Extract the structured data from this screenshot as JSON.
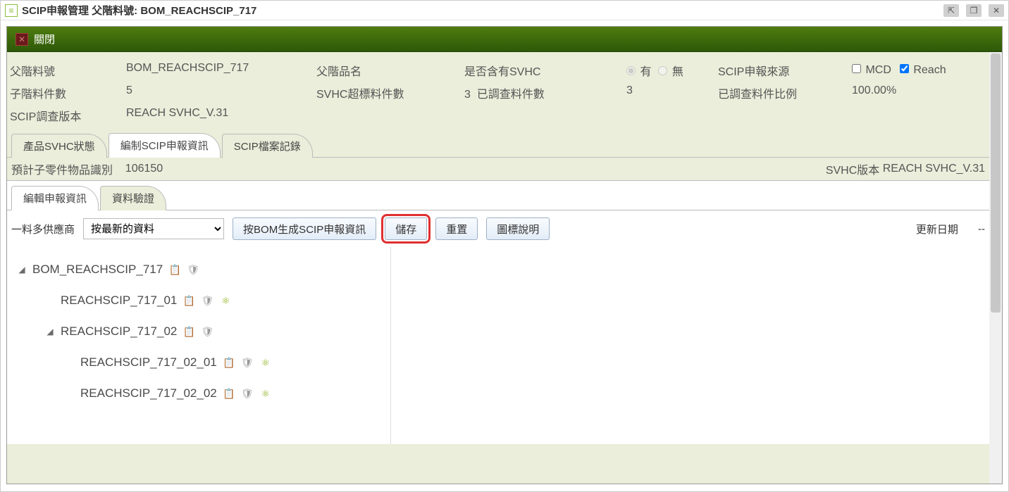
{
  "window": {
    "title": "SCIP申報管理 父階料號: BOM_REACHSCIP_717",
    "win_pin": "⇱",
    "win_max": "❐",
    "win_close": "✕"
  },
  "toolbar": {
    "close_label": "關閉"
  },
  "info": {
    "parent_pn_label": "父階料號",
    "parent_pn_value": "BOM_REACHSCIP_717",
    "parent_name_label": "父階品名",
    "svhc_contain_label": "是否含有SVHC",
    "svhc_yes": "有",
    "svhc_no": "無",
    "scip_source_label": "SCIP申報來源",
    "mcd_label": "MCD",
    "reach_label": "Reach",
    "child_count_label": "子階料件數",
    "child_count_value": "5",
    "svhc_exceed_label": "SVHC超標料件數",
    "svhc_exceed_value": "3",
    "surveyed_label": "已調查料件數",
    "surveyed_value": "3",
    "surveyed_pct_label": "已調查料件比例",
    "surveyed_pct_value": "100.00%",
    "scip_survey_ver_label": "SCIP調查版本",
    "scip_survey_ver_value": "REACH SVHC_V.31"
  },
  "tabs1": {
    "product_svhc_status": "產品SVHC狀態",
    "scip_decl_info": "編制SCIP申報資訊",
    "scip_file_log": "SCIP檔案記錄"
  },
  "sub": {
    "est_child_id_label": "預計子零件物品識別",
    "est_child_id_value": "106150",
    "svhc_ver_label": "SVHC版本",
    "svhc_ver_value": "REACH SVHC_V.31"
  },
  "tabs2": {
    "edit_decl": "編輯申報資訊",
    "data_validate": "資料驗證"
  },
  "controls": {
    "multi_supplier_label": "一料多供應商",
    "combo_selected": "按最新的資料",
    "btn_gen_by_bom": "按BOM生成SCIP申報資訊",
    "btn_save": "儲存",
    "btn_reset": "重置",
    "btn_icon_legend": "圖標說明",
    "update_date_label": "更新日期",
    "update_date_value": "--"
  },
  "tree": [
    {
      "level": 0,
      "expanded": true,
      "label": "BOM_REACHSCIP_717",
      "icons": [
        "clip",
        "shield"
      ]
    },
    {
      "level": 1,
      "expanded": null,
      "label": "REACHSCIP_717_01",
      "icons": [
        "clip",
        "shield",
        "cluster"
      ]
    },
    {
      "level": 1,
      "expanded": true,
      "label": "REACHSCIP_717_02",
      "icons": [
        "clip",
        "shield"
      ]
    },
    {
      "level": 2,
      "expanded": null,
      "label": "REACHSCIP_717_02_01",
      "icons": [
        "clip",
        "shield",
        "cluster"
      ]
    },
    {
      "level": 2,
      "expanded": null,
      "label": "REACHSCIP_717_02_02",
      "icons": [
        "clip",
        "shield",
        "cluster"
      ]
    }
  ]
}
